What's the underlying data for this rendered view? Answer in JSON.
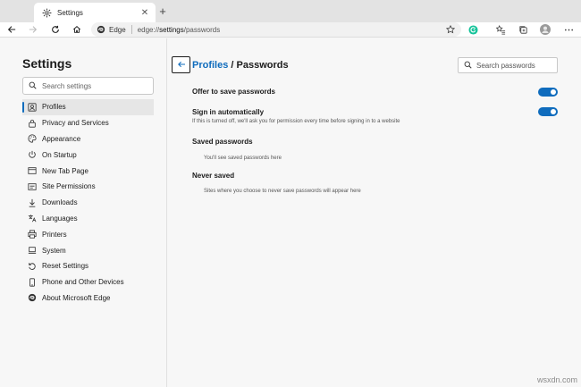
{
  "tab": {
    "title": "Settings"
  },
  "address": {
    "site": "Edge",
    "url_prefix": "edge://",
    "url_bold": "settings",
    "url_suffix": "/passwords"
  },
  "sidebar": {
    "title": "Settings",
    "search_placeholder": "Search settings",
    "items": [
      {
        "label": "Profiles",
        "icon": "profile-icon",
        "active": true
      },
      {
        "label": "Privacy and Services",
        "icon": "lock-icon"
      },
      {
        "label": "Appearance",
        "icon": "appearance-icon"
      },
      {
        "label": "On Startup",
        "icon": "power-icon"
      },
      {
        "label": "New Tab Page",
        "icon": "newtab-icon"
      },
      {
        "label": "Site Permissions",
        "icon": "site-permissions-icon"
      },
      {
        "label": "Downloads",
        "icon": "download-icon"
      },
      {
        "label": "Languages",
        "icon": "languages-icon"
      },
      {
        "label": "Printers",
        "icon": "printer-icon"
      },
      {
        "label": "System",
        "icon": "system-icon"
      },
      {
        "label": "Reset Settings",
        "icon": "reset-icon"
      },
      {
        "label": "Phone and Other Devices",
        "icon": "phone-icon"
      },
      {
        "label": "About Microsoft Edge",
        "icon": "edge-icon"
      }
    ]
  },
  "main": {
    "breadcrumb_link": "Profiles",
    "breadcrumb_sep": "/",
    "breadcrumb_current": "Passwords",
    "search_placeholder": "Search passwords",
    "offer_save": {
      "title": "Offer to save passwords",
      "enabled": true
    },
    "sign_in_auto": {
      "title": "Sign in automatically",
      "description": "If this is turned off, we'll ask you for permission every time before signing in to a website",
      "enabled": true
    },
    "saved": {
      "title": "Saved passwords",
      "empty_text": "You'll see saved passwords here"
    },
    "never_saved": {
      "title": "Never saved",
      "empty_text": "Sites where you choose to never save passwords will appear here"
    }
  },
  "watermark": "wsxdn.com",
  "colors": {
    "accent": "#0f6cbd",
    "grammarly": "#15c39a"
  }
}
